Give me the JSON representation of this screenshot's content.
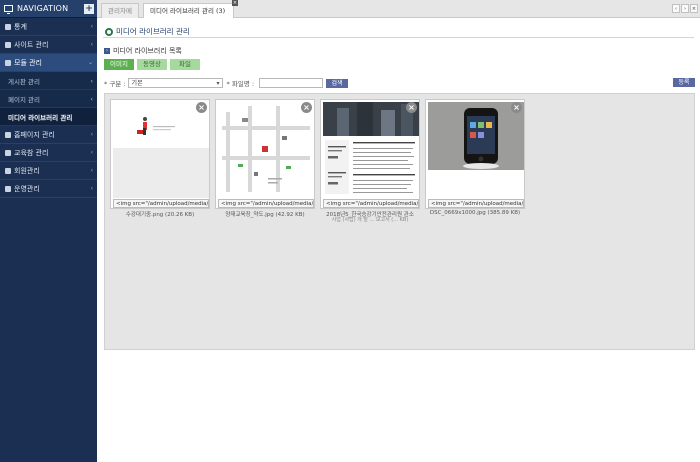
{
  "sidebar": {
    "title": "NAVIGATION",
    "add_label": "+",
    "items": [
      {
        "label": "통계"
      },
      {
        "label": "사이트 관리"
      },
      {
        "label": "모듈 관리"
      }
    ],
    "subitems": [
      {
        "label": "게시판 관리"
      },
      {
        "label": "페이지 관리"
      },
      {
        "label": "미디어 라이브러리 관리"
      }
    ],
    "items_after": [
      {
        "label": "홈페이지 관리"
      },
      {
        "label": "교육참 관리"
      },
      {
        "label": "회원관리"
      },
      {
        "label": "운영관리"
      }
    ]
  },
  "tabs": [
    {
      "label": "관리자메인"
    },
    {
      "label": "미디어 라이브러리 관리 (3)"
    }
  ],
  "tab_nav": [
    "‹",
    "›",
    "×"
  ],
  "page": {
    "title": "미디어 라이브러리 관리",
    "section_title": "미디어 라이브러리 목록",
    "type_tabs": [
      "이미지",
      "동영상",
      "파일"
    ],
    "filter": {
      "category_label": "* 구분 :",
      "category_value": "기본",
      "filename_label": "* 파일명 :",
      "search_label": "검색",
      "register_label": "등록"
    }
  },
  "media": [
    {
      "code": "<img src=\"/admin/upload/media/i",
      "name": "수강대기중.png (20.26 KB)",
      "name2": ""
    },
    {
      "code": "<img src=\"/admin/upload/media/i",
      "name": "양재교육장_약도.jpg (42.92 KB)",
      "name2": ""
    },
    {
      "code": "<img src=\"/admin/upload/media/2",
      "name": "2018년5_한국승강기안전관리원 관소",
      "name2": "사업 (사업) 개 발 ... 보고서 (... KB)"
    },
    {
      "code": "<img src=\"/admin/upload/media/i",
      "name": "DSC_0669x1000.jpg (385.89 KB)",
      "name2": ""
    }
  ]
}
